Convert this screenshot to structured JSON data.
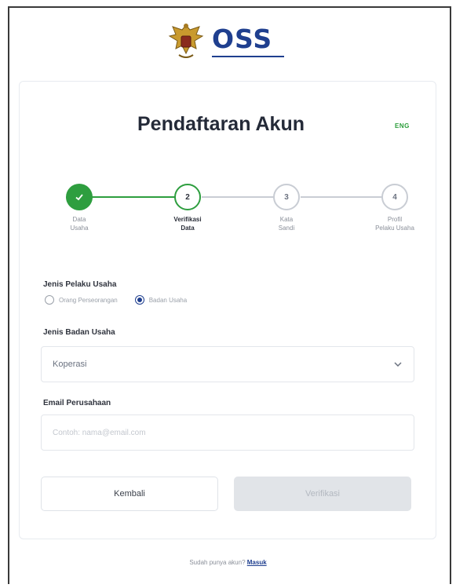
{
  "brand": {
    "name": "OSS"
  },
  "card": {
    "title": "Pendaftaran Akun",
    "language": "ENG"
  },
  "stepper": {
    "steps": [
      {
        "number": "✓",
        "label_line1": "Data",
        "label_line2": "Usaha",
        "state": "done"
      },
      {
        "number": "2",
        "label_line1": "Verifikasi",
        "label_line2": "Data",
        "state": "active"
      },
      {
        "number": "3",
        "label_line1": "Kata",
        "label_line2": "Sandi",
        "state": "todo"
      },
      {
        "number": "4",
        "label_line1": "Profil",
        "label_line2": "Pelaku Usaha",
        "state": "todo"
      }
    ]
  },
  "form": {
    "jenis_pelaku_label": "Jenis Pelaku Usaha",
    "radio_options": [
      {
        "label": "Orang Perseorangan",
        "checked": false
      },
      {
        "label": "Badan Usaha",
        "checked": true
      }
    ],
    "jenis_badan_label": "Jenis Badan Usaha",
    "jenis_badan_value": "Koperasi",
    "email_label": "Email Perusahaan",
    "email_placeholder": "Contoh: nama@email.com"
  },
  "buttons": {
    "back": "Kembali",
    "verify": "Verifikasi"
  },
  "footer": {
    "text": "Sudah punya akun?",
    "link": "Masuk"
  },
  "colors": {
    "primary": "#1f3f8f",
    "success": "#2e9e3f",
    "disabled": "#e1e4e8"
  },
  "icons": {
    "emblem": "garuda-emblem-icon",
    "check": "check-icon",
    "dropdown": "chevron-down-icon"
  }
}
